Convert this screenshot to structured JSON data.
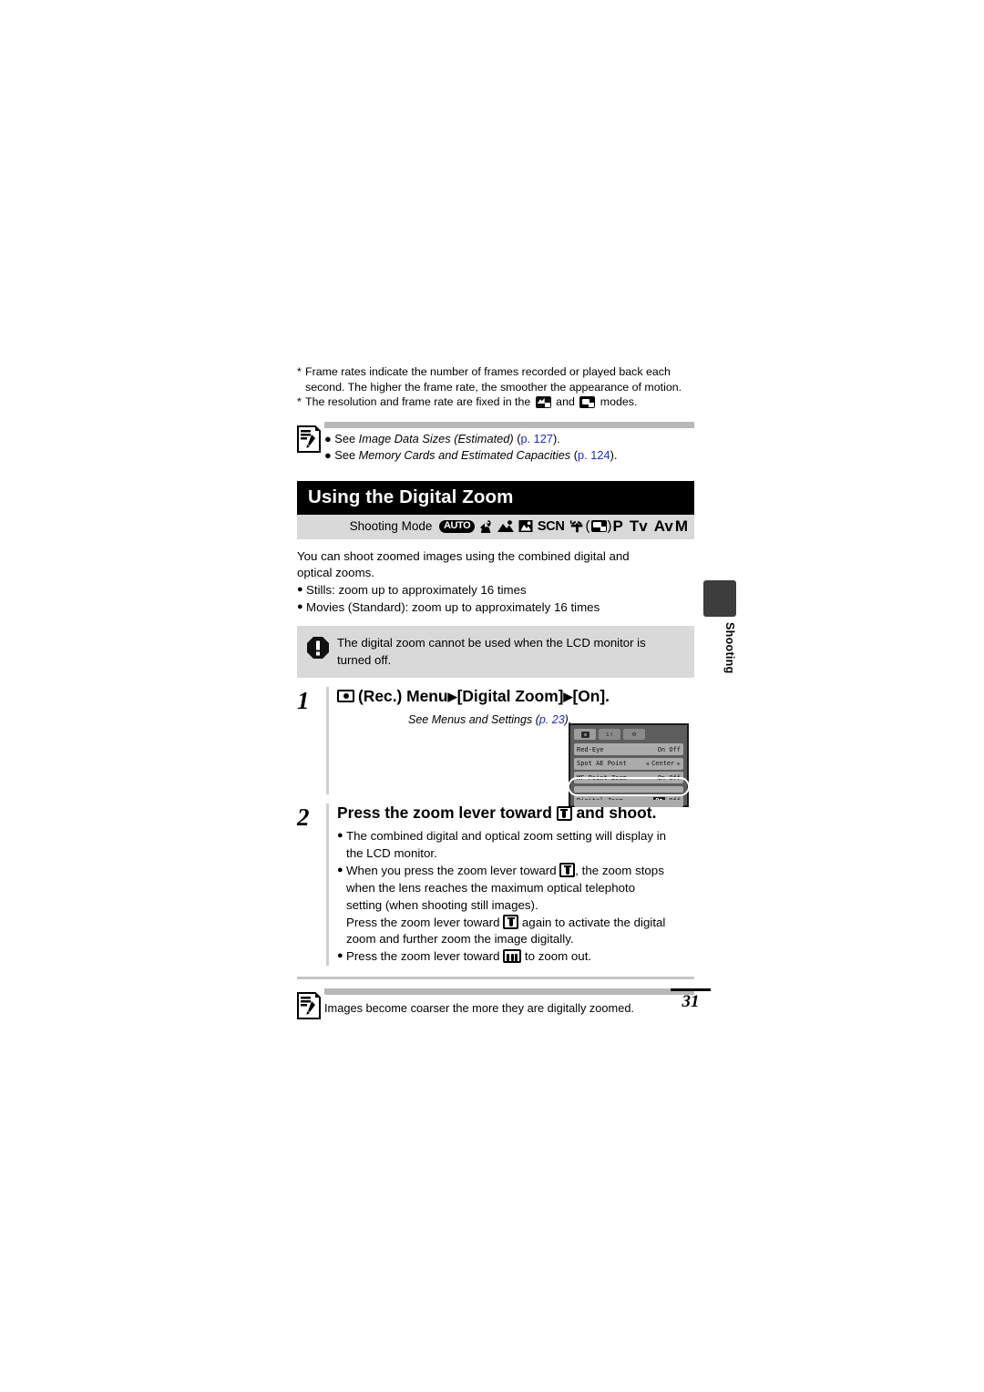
{
  "footnotes": [
    {
      "marker": "*",
      "line1": "Frame rates indicate the number of frames recorded or played back each",
      "line2": "second. The higher the frame rate, the smoother the appearance of motion."
    },
    {
      "marker": "*",
      "pre": "The resolution and frame rate are fixed in the",
      "mid": "and",
      "post": "modes.",
      "icon1": "movie-standard-mode-icon",
      "icon2": "movie-compact-mode-icon"
    }
  ],
  "top_note": {
    "icon": "note-pencil-icon",
    "items": [
      {
        "bullet": "●",
        "see": "See",
        "title": "Image Data Sizes (Estimated)",
        "ref_open": "(",
        "ref": "p. 127",
        "ref_close": ")."
      },
      {
        "bullet": "●",
        "see": "See",
        "title": "Memory Cards and Estimated Capacities",
        "ref_open": "(",
        "ref": "p. 124",
        "ref_close": ")."
      }
    ]
  },
  "section": {
    "title": "Using the Digital Zoom",
    "mode_label": "Shooting Mode",
    "modes": [
      {
        "name": "auto-mode-icon",
        "label": "AUTO"
      },
      {
        "name": "portrait-mode-icon",
        "label": ""
      },
      {
        "name": "landscape-mode-icon",
        "label": ""
      },
      {
        "name": "night-scene-mode-icon",
        "label": ""
      },
      {
        "name": "scn-mode-label",
        "label": "SCN"
      },
      {
        "name": "movie-mode-icon",
        "label": ""
      },
      {
        "name": "paren-open",
        "label": "("
      },
      {
        "name": "movie-standard-mode-icon",
        "label": ""
      },
      {
        "name": "paren-close",
        "label": ")"
      },
      {
        "name": "program-mode-label",
        "label": "P"
      },
      {
        "name": "tv-mode-label",
        "label": "Tv"
      },
      {
        "name": "av-mode-label",
        "label": "Av"
      },
      {
        "name": "manual-mode-label",
        "label": "M"
      }
    ]
  },
  "intro": {
    "line1": "You can shoot zoomed images using the combined digital and",
    "line2": "optical zooms.",
    "bullets": [
      "Stills: zoom up to approximately 16 times",
      "Movies (Standard): zoom up to approximately 16 times"
    ]
  },
  "warning": {
    "icon": "warning-exclamation-icon",
    "line1": "The digital zoom cannot be used when the LCD monitor is",
    "line2": "turned off."
  },
  "steps": [
    {
      "number": "1",
      "icon": "rec-camera-icon",
      "head_a": "(Rec.) Menu",
      "arrow": "▶",
      "head_b": "[Digital Zoom]",
      "head_c": "[On].",
      "sub_it": "See Menus and Settings",
      "sub_ref_open": "(",
      "sub_ref": "p. 23",
      "sub_ref_close": ")."
    },
    {
      "number": "2",
      "head_a": "Press the zoom lever toward",
      "lever_icon": "zoom-telephoto-icon",
      "head_b": "and shoot.",
      "bullets": [
        {
          "kind": "dot",
          "line1": "The combined digital and optical zoom setting will display in",
          "line2": "the LCD monitor."
        },
        {
          "kind": "dot",
          "pre": "When you press the zoom lever toward",
          "icon": "zoom-telephoto-icon",
          "post": ", the zoom stops",
          "line2": "when the lens reaches the maximum optical telephoto",
          "line3": "setting (when shooting still images)."
        },
        {
          "kind": "plain",
          "pre": "Press the zoom lever toward",
          "icon": "zoom-telephoto-icon",
          "post": "again to activate the digital",
          "line2": "zoom and further zoom the image digitally."
        },
        {
          "kind": "dot",
          "pre": "Press the zoom lever toward",
          "icon": "zoom-wide-icon",
          "post": "to zoom out."
        }
      ]
    }
  ],
  "lcd": {
    "tabs": [
      {
        "name": "lcd-tab-shooting",
        "glyph": "camera",
        "active": true
      },
      {
        "name": "lcd-tab-setup",
        "glyph": "ı↑",
        "active": false
      },
      {
        "name": "lcd-tab-my-camera",
        "glyph": "⚙",
        "active": false
      }
    ],
    "rows": [
      {
        "label": "Red-Eye",
        "value_on": "On",
        "value_off": "Off",
        "selected": false,
        "type": "onoff"
      },
      {
        "label": "Spot AE Point",
        "value": "Center",
        "type": "arrows"
      },
      {
        "label": "MF-Point Zoom",
        "value_on": "On",
        "value_off": "Off",
        "selected": false,
        "type": "onoff"
      },
      {
        "label": "Digital Zoom",
        "value_on": "On",
        "value_off": "Off",
        "selected": true,
        "type": "onoff"
      }
    ]
  },
  "bottom_note": {
    "icon": "note-pencil-icon",
    "text": "Images become coarser the more they are digitally zoomed."
  },
  "side_tab": {
    "label": "Shooting"
  },
  "page_number": "31",
  "colors": {
    "accent_link": "#1b2ad8",
    "title_bar": "#000000",
    "mode_bar": "#d9d9d9",
    "note_bar": "#b8b8b8",
    "warning_bg": "#d9d9d9",
    "side_tab": "#3d3d3d"
  }
}
